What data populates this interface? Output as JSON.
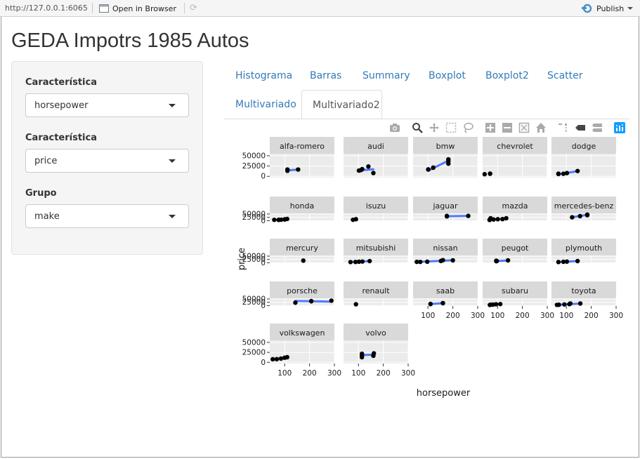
{
  "topbar": {
    "url": "http://127.0.0.1:6065",
    "open_browser": "Open in Browser",
    "publish": "Publish"
  },
  "page": {
    "title": "GEDA Impotrs 1985 Autos"
  },
  "sidebar": {
    "fields": [
      {
        "label": "Característica",
        "value": "horsepower"
      },
      {
        "label": "Característica",
        "value": "price"
      },
      {
        "label": "Grupo",
        "value": "make"
      }
    ]
  },
  "tabs": [
    "Histograma",
    "Barras",
    "Summary",
    "Boxplot",
    "Boxplot2",
    "Scatter",
    "Multivariado",
    "Multivariado2"
  ],
  "active_tab": "Multivariado2",
  "modebar": [
    "camera-icon",
    "zoom-icon",
    "pan-icon",
    "box-select-icon",
    "lasso-icon",
    "zoom-in-icon",
    "zoom-out-icon",
    "autoscale-icon",
    "reset-axes-icon",
    "spike-lines-icon",
    "hover-closest-icon",
    "hover-compare-icon",
    "plotly-logo-icon"
  ],
  "colors": {
    "accent": "#337ab7",
    "line": "#3366FF",
    "panel": "#ebebeb",
    "strip": "#d9d9d9"
  },
  "chart_data": {
    "type": "scatter",
    "xlabel": "horsepower",
    "ylabel": "price",
    "x_ticks": [
      100,
      200,
      300
    ],
    "y_ticks": [
      "50000",
      "25000",
      "0"
    ],
    "xlim": [
      40,
      300
    ],
    "ylim": [
      -3000,
      55000
    ],
    "facets": [
      {
        "name": "alfa-romero",
        "points": [
          [
            111,
            13495
          ],
          [
            111,
            16500
          ],
          [
            154,
            16500
          ]
        ],
        "fit": [
          [
            111,
            14500
          ],
          [
            154,
            16500
          ]
        ]
      },
      {
        "name": "audi",
        "points": [
          [
            102,
            13950
          ],
          [
            115,
            17450
          ],
          [
            110,
            15250
          ],
          [
            140,
            23875
          ],
          [
            160,
            8000
          ]
        ],
        "fit": [
          [
            102,
            14500
          ],
          [
            160,
            17000
          ]
        ]
      },
      {
        "name": "bmw",
        "points": [
          [
            101,
            16430
          ],
          [
            101,
            16925
          ],
          [
            121,
            20970
          ],
          [
            121,
            21105
          ],
          [
            182,
            36880
          ],
          [
            182,
            41315
          ],
          [
            182,
            30760
          ]
        ],
        "fit": [
          [
            101,
            14000
          ],
          [
            182,
            38000
          ]
        ]
      },
      {
        "name": "chevrolet",
        "points": [
          [
            48,
            5151
          ],
          [
            70,
            6295
          ],
          [
            70,
            6575
          ]
        ],
        "fit": []
      },
      {
        "name": "dodge",
        "points": [
          [
            68,
            5572
          ],
          [
            68,
            6377
          ],
          [
            102,
            7957
          ],
          [
            88,
            6229
          ],
          [
            145,
            12964
          ]
        ],
        "fit": [
          [
            68,
            5000
          ],
          [
            145,
            12500
          ]
        ]
      },
      {
        "name": "honda",
        "points": [
          [
            58,
            6479
          ],
          [
            76,
            6855
          ],
          [
            76,
            5399
          ],
          [
            86,
            7295
          ],
          [
            100,
            8845
          ],
          [
            100,
            10295
          ],
          [
            110,
            12945
          ]
        ],
        "fit": [
          [
            58,
            5500
          ],
          [
            110,
            12000
          ]
        ]
      },
      {
        "name": "isuzu",
        "points": [
          [
            78,
            6785
          ],
          [
            90,
            11048
          ]
        ],
        "fit": [
          [
            78,
            6785
          ],
          [
            90,
            11048
          ]
        ]
      },
      {
        "name": "jaguar",
        "points": [
          [
            176,
            32250
          ],
          [
            176,
            35550
          ],
          [
            262,
            36000
          ]
        ],
        "fit": [
          [
            176,
            33500
          ],
          [
            262,
            36000
          ]
        ]
      },
      {
        "name": "mazda",
        "points": [
          [
            68,
            5195
          ],
          [
            68,
            6095
          ],
          [
            84,
            8845
          ],
          [
            101,
            10945
          ],
          [
            120,
            11845
          ],
          [
            135,
            18280
          ],
          [
            72,
            18344
          ]
        ],
        "fit": [
          [
            68,
            7000
          ],
          [
            135,
            14500
          ]
        ]
      },
      {
        "name": "mercedes-benz",
        "points": [
          [
            123,
            25552
          ],
          [
            155,
            34184
          ],
          [
            184,
            40960
          ],
          [
            184,
            45400
          ]
        ],
        "fit": [
          [
            123,
            26000
          ],
          [
            184,
            44000
          ]
        ]
      },
      {
        "name": "mercury",
        "points": [
          [
            175,
            16503
          ]
        ],
        "fit": []
      },
      {
        "name": "mitsubishi",
        "points": [
          [
            68,
            5389
          ],
          [
            88,
            6189
          ],
          [
            102,
            8189
          ],
          [
            116,
            9279
          ],
          [
            145,
            12629
          ]
        ],
        "fit": [
          [
            68,
            5500
          ],
          [
            145,
            12500
          ]
        ]
      },
      {
        "name": "nissan",
        "points": [
          [
            55,
            7099
          ],
          [
            69,
            6649
          ],
          [
            97,
            8249
          ],
          [
            152,
            13499
          ],
          [
            160,
            19699
          ],
          [
            200,
            18399
          ]
        ],
        "fit": [
          [
            55,
            6000
          ],
          [
            200,
            19000
          ]
        ]
      },
      {
        "name": "peugot",
        "points": [
          [
            95,
            11900
          ],
          [
            97,
            13200
          ],
          [
            142,
            18150
          ],
          [
            95,
            15580
          ]
        ],
        "fit": [
          [
            95,
            13000
          ],
          [
            142,
            17500
          ]
        ]
      },
      {
        "name": "plymouth",
        "points": [
          [
            68,
            5572
          ],
          [
            88,
            7609
          ],
          [
            102,
            8921
          ],
          [
            145,
            12764
          ]
        ],
        "fit": [
          [
            68,
            5500
          ],
          [
            145,
            12500
          ]
        ]
      },
      {
        "name": "porsche",
        "points": [
          [
            143,
            22018
          ],
          [
            207,
            32528
          ],
          [
            207,
            34028
          ],
          [
            288,
            37028
          ]
        ],
        "fit": [
          [
            143,
            35000
          ],
          [
            288,
            30000
          ]
        ]
      },
      {
        "name": "renault",
        "points": [
          [
            90,
            9895
          ]
        ],
        "fit": []
      },
      {
        "name": "saab",
        "points": [
          [
            110,
            11850
          ],
          [
            110,
            12170
          ],
          [
            160,
            18620
          ],
          [
            160,
            18150
          ]
        ],
        "fit": [
          [
            110,
            12000
          ],
          [
            160,
            18400
          ]
        ]
      },
      {
        "name": "subaru",
        "points": [
          [
            69,
            5118
          ],
          [
            73,
            7053
          ],
          [
            82,
            7775
          ],
          [
            94,
            9960
          ],
          [
            111,
            11259
          ]
        ],
        "fit": [
          [
            69,
            5500
          ],
          [
            111,
            10500
          ]
        ]
      },
      {
        "name": "toyota",
        "points": [
          [
            62,
            5348
          ],
          [
            70,
            6338
          ],
          [
            92,
            8778
          ],
          [
            112,
            11199
          ],
          [
            116,
            15998
          ],
          [
            156,
            15750
          ]
        ],
        "fit": [
          [
            62,
            5500
          ],
          [
            156,
            15500
          ]
        ]
      },
      {
        "name": "volkswagen",
        "points": [
          [
            52,
            7775
          ],
          [
            85,
            9495
          ],
          [
            100,
            11595
          ],
          [
            110,
            12940
          ],
          [
            68,
            7995
          ]
        ],
        "fit": [
          [
            52,
            7500
          ],
          [
            110,
            12500
          ]
        ]
      },
      {
        "name": "volvo",
        "points": [
          [
            114,
            12940
          ],
          [
            114,
            16845
          ],
          [
            162,
            22470
          ],
          [
            114,
            21485
          ],
          [
            160,
            16515
          ]
        ],
        "fit": [
          [
            114,
            18000
          ],
          [
            162,
            19500
          ]
        ]
      }
    ]
  }
}
